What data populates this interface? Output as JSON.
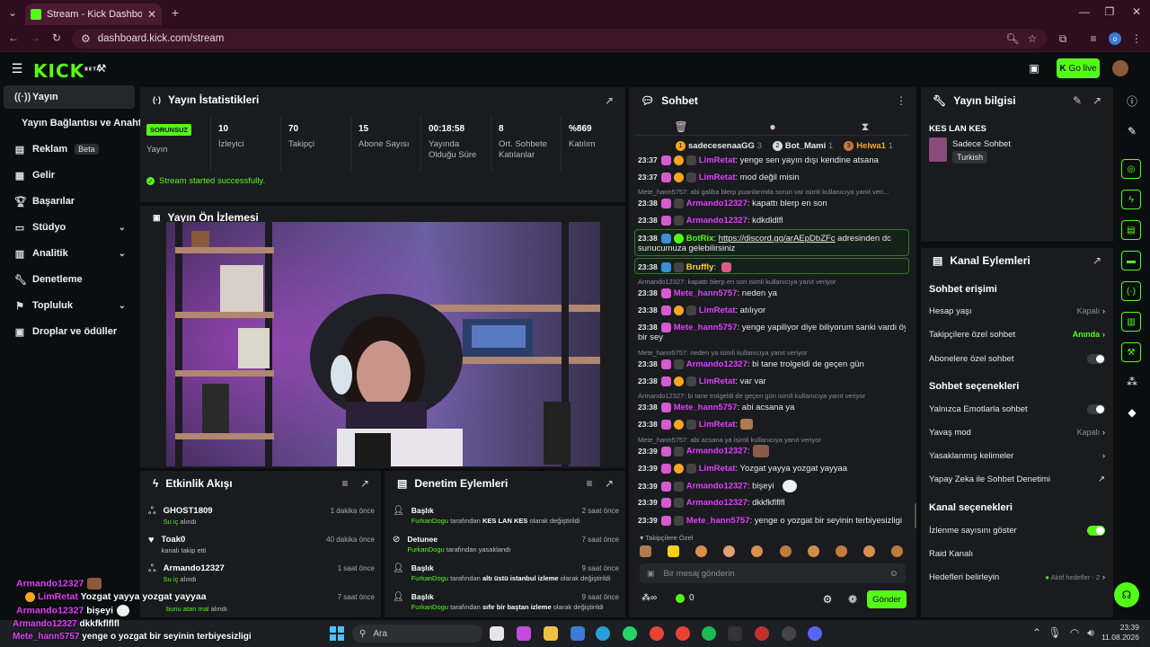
{
  "browser": {
    "tab_title": "Stream - Kick Dashboard",
    "url": "dashboard.kick.com/stream",
    "profile_initial": "o"
  },
  "header": {
    "logo": "KICK",
    "logo_badge": "BETA",
    "go_live": "Go live"
  },
  "sidebar": {
    "items": [
      {
        "label": "Yayın"
      },
      {
        "label": "Yayın Bağlantısı ve Anahtarı"
      },
      {
        "label": "Reklam",
        "badge": "Beta"
      },
      {
        "label": "Gelir"
      },
      {
        "label": "Başarılar"
      },
      {
        "label": "Stüdyo"
      },
      {
        "label": "Analitik"
      },
      {
        "label": "Denetleme"
      },
      {
        "label": "Topluluk"
      },
      {
        "label": "Droplar ve ödüller"
      }
    ]
  },
  "stats": {
    "title": "Yayın İstatistikleri",
    "status_badge": "SORUNSUZ",
    "status_label": "Yayın",
    "cells": [
      {
        "value": "10",
        "label": "İzleyici"
      },
      {
        "value": "70",
        "label": "Takipçi"
      },
      {
        "value": "15",
        "label": "Abone Sayısı"
      },
      {
        "value": "00:18:58",
        "label": "Yayında Olduğu Süre"
      },
      {
        "value": "8",
        "label": "Ort. Sohbete Katılanlar"
      },
      {
        "value": "%869",
        "label": "Katılım"
      }
    ],
    "success_msg": "Stream started successfully."
  },
  "preview": {
    "title": "Yayın Ön İzlemesi"
  },
  "activity": {
    "title": "Etkinlik Akışı",
    "items": [
      {
        "name": "GHOST1809",
        "hl": "Su iç",
        "rest": " alındı",
        "time": "1 dakika önce"
      },
      {
        "name": "Toak0",
        "hl": "",
        "rest": "kanalı takip etti",
        "time": "40 dakika önce"
      },
      {
        "name": "Armando12327",
        "hl": "Su iç",
        "rest": " alındı",
        "time": "1 saat önce"
      },
      {
        "name": "",
        "hl": "bunu atan mal",
        "rest": " alındı",
        "time": "7 saat önce"
      }
    ]
  },
  "moderation": {
    "title": "Denetim Eylemleri",
    "items": [
      {
        "title": "Başlık",
        "user": "FurkanDogu",
        "pre": " tarafından ",
        "obj": "KES LAN KES",
        "post": " olarak değiştirildi",
        "time": "2 saat önce"
      },
      {
        "title": "Detunee",
        "user": "FurkanDogu",
        "pre": " tarafından yasaklandı",
        "obj": "",
        "post": "",
        "time": "7 saat önce"
      },
      {
        "title": "Başlık",
        "user": "FurkanDogu",
        "pre": " tarafından ",
        "obj": "altı üstü istanbul izleme",
        "post": " olarak değiştirildi",
        "time": "9 saat önce"
      },
      {
        "title": "Başlık",
        "user": "FurkanDogu",
        "pre": " tarafından ",
        "obj": "sıfır bir baştan izleme",
        "post": " olarak değiştirildi",
        "time": "9 saat önce"
      }
    ]
  },
  "chat": {
    "title": "Sohbet",
    "top_gifters": [
      {
        "name": "sadecesenaaGG",
        "count": "3"
      },
      {
        "name": "Bot_Mami",
        "count": "1"
      },
      {
        "name": "Helwa1",
        "count": "1"
      }
    ],
    "lines": [
      {
        "kind": "msg",
        "ts": "23:37",
        "user": "LimRetat",
        "color": "#e040fb",
        "text": ": yenge sen yayın dışı kendine atsana"
      },
      {
        "kind": "msg",
        "ts": "23:37",
        "user": "LimRetat",
        "color": "#e040fb",
        "text": ": mod değil misin"
      },
      {
        "kind": "reply",
        "text": "Mete_hann5757: abi galiba blerp puanlarında sorun var isimli kullanıcıya yanıt veri..."
      },
      {
        "kind": "msg",
        "ts": "23:38",
        "user": "Armando12327",
        "color": "#e040fb",
        "text": ": kapattı blerp en son"
      },
      {
        "kind": "msg",
        "ts": "23:38",
        "user": "Armando12327",
        "color": "#e040fb",
        "text": ": kdkdldlfl"
      },
      {
        "kind": "bot",
        "ts": "23:38",
        "user": "BotRix",
        "color": "#53fc18",
        "link": "https://discord.gg/arAEpDbZFc",
        "text": " adresinden dc",
        "text2": "sunucumuza gelebilirsiniz"
      },
      {
        "kind": "bruffly",
        "ts": "23:38",
        "user": "Bruffly",
        "color": "#ffd23f",
        "text": ":"
      },
      {
        "kind": "reply",
        "text": "Armando12327: kapattı blerp en son isimli kullanıcıya yanıt veriyor"
      },
      {
        "kind": "msg",
        "ts": "23:38",
        "user": "Mete_hann5757",
        "color": "#e040fb",
        "text": ": neden ya"
      },
      {
        "kind": "msg",
        "ts": "23:38",
        "user": "LimRetat",
        "color": "#e040fb",
        "text": ": atılıyor"
      },
      {
        "kind": "msg2",
        "ts": "23:38",
        "user": "Mete_hann5757",
        "color": "#e040fb",
        "text": ": yenge yapiliyor diye biliyorum sanki vardi öyle",
        "text2": "bir sey"
      },
      {
        "kind": "reply",
        "text": "Mete_hann5757: neden ya isimli kullanıcıya yanıt veriyor"
      },
      {
        "kind": "msg",
        "ts": "23:38",
        "user": "Armando12327",
        "color": "#e040fb",
        "text": ": bi tane trolgeldi de geçen gün"
      },
      {
        "kind": "msg",
        "ts": "23:38",
        "user": "LimRetat",
        "color": "#e040fb",
        "text": ": var var"
      },
      {
        "kind": "reply",
        "text": "Armando12327: bi tane trolgeldi de geçen gün isimli kullanıcıya yanıt veriyor"
      },
      {
        "kind": "msg",
        "ts": "23:38",
        "user": "Mete_hann5757",
        "color": "#e040fb",
        "text": ": abi acsana ya"
      },
      {
        "kind": "msg",
        "ts": "23:38",
        "user": "LimRetat",
        "color": "#e040fb",
        "text": ":"
      },
      {
        "kind": "reply",
        "text": "Mete_hann5757: abi acsana ya isimli kullanıcıya yanıt veriyor"
      },
      {
        "kind": "msg",
        "ts": "23:39",
        "user": "Armando12327",
        "color": "#e040fb",
        "text": ":"
      },
      {
        "kind": "msg",
        "ts": "23:39",
        "user": "LimRetat",
        "color": "#e040fb",
        "text": ": Yozgat yayya yozgat yayyaa"
      },
      {
        "kind": "msg",
        "ts": "23:39",
        "user": "Armando12327",
        "color": "#e040fb",
        "text": ": bişeyi"
      },
      {
        "kind": "msg",
        "ts": "23:39",
        "user": "Armando12327",
        "color": "#e040fb",
        "text": ": dkkfkflflfl"
      },
      {
        "kind": "msg",
        "ts": "23:39",
        "user": "Mete_hann5757",
        "color": "#e040fb",
        "text": ": yenge o yozgat bir seyinin terbiyesizligi"
      }
    ],
    "emote_section": "Takipçilere Özel",
    "input_placeholder": "Bir mesaj gönderin",
    "points": "0",
    "send": "Gönder"
  },
  "stream_info": {
    "title": "Yayın bilgisi",
    "stream_title": "KES LAN KES",
    "category": "Sadece Sohbet",
    "tag": "Turkish"
  },
  "channel_actions": {
    "title": "Kanal Eylemleri",
    "sec_access": "Sohbet erişimi",
    "account_age": {
      "label": "Hesap yaşı",
      "value": "Kapalı"
    },
    "followers_only": {
      "label": "Takipçilere özel sohbet",
      "value": "Anında"
    },
    "subscribers_only": {
      "label": "Abonelere özel sohbet"
    },
    "sec_options": "Sohbet seçenekleri",
    "emote_only": {
      "label": "Yalnızca Emotlarla sohbet"
    },
    "slow_mode": {
      "label": "Yavaş mod",
      "value": "Kapalı"
    },
    "banned_words": {
      "label": "Yasaklanmış kelimeler"
    },
    "ai_moderation": {
      "label": "Yapay Zeka ile Sohbet Denetimi"
    },
    "sec_channel": "Kanal seçenekleri",
    "show_viewers": {
      "label": "İzlenme sayısını göster"
    },
    "raid": {
      "label": "Raid Kanalı"
    },
    "goals": {
      "label": "Hedefleri belirleyin",
      "value": "Aktif hedefler - 2"
    }
  },
  "overlay": {
    "lines": [
      {
        "user": "Armando12327",
        "text": ""
      },
      {
        "user": "LimRetat",
        "text": "Yozgat yayya yozgat yayyaa"
      },
      {
        "user": "Armando12327",
        "text": "bişeyi"
      },
      {
        "user": "Armando12327",
        "text": "dkkfkflflfl"
      },
      {
        "user": "Mete_hann5757",
        "text": "yenge o yozgat bir seyinin terbiyesizligi"
      }
    ]
  },
  "taskbar": {
    "search": "Ara",
    "time": "23:39",
    "date": "11.08.2026"
  }
}
